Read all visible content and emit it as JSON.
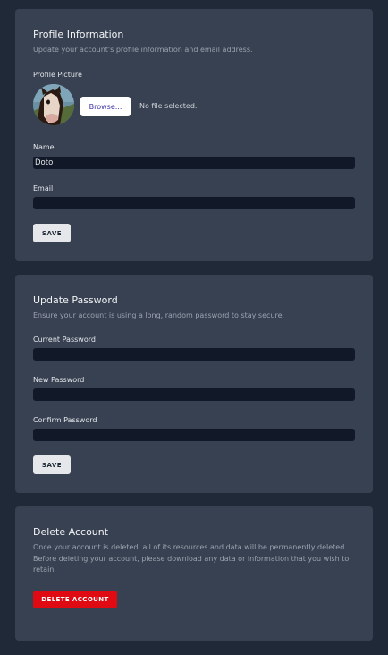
{
  "profile": {
    "title": "Profile Information",
    "subtitle": "Update your account's profile information and email address.",
    "picture_label": "Profile Picture",
    "browse_label": "Browse...",
    "file_status": "No file selected.",
    "name_label": "Name",
    "name_value": "Doto",
    "email_label": "Email",
    "email_value": "",
    "save_label": "SAVE"
  },
  "password": {
    "title": "Update Password",
    "subtitle": "Ensure your account is using a long, random password to stay secure.",
    "current_label": "Current Password",
    "new_label": "New Password",
    "confirm_label": "Confirm Password",
    "save_label": "SAVE"
  },
  "delete": {
    "title": "Delete Account",
    "text": "Once your account is deleted, all of its resources and data will be permanently deleted. Before deleting your account, please download any data or information that you wish to retain.",
    "button_label": "DELETE ACCOUNT"
  },
  "colors": {
    "page_bg": "#1f2937",
    "card_bg": "#374151",
    "input_bg": "#111827",
    "danger": "#e00b12"
  }
}
